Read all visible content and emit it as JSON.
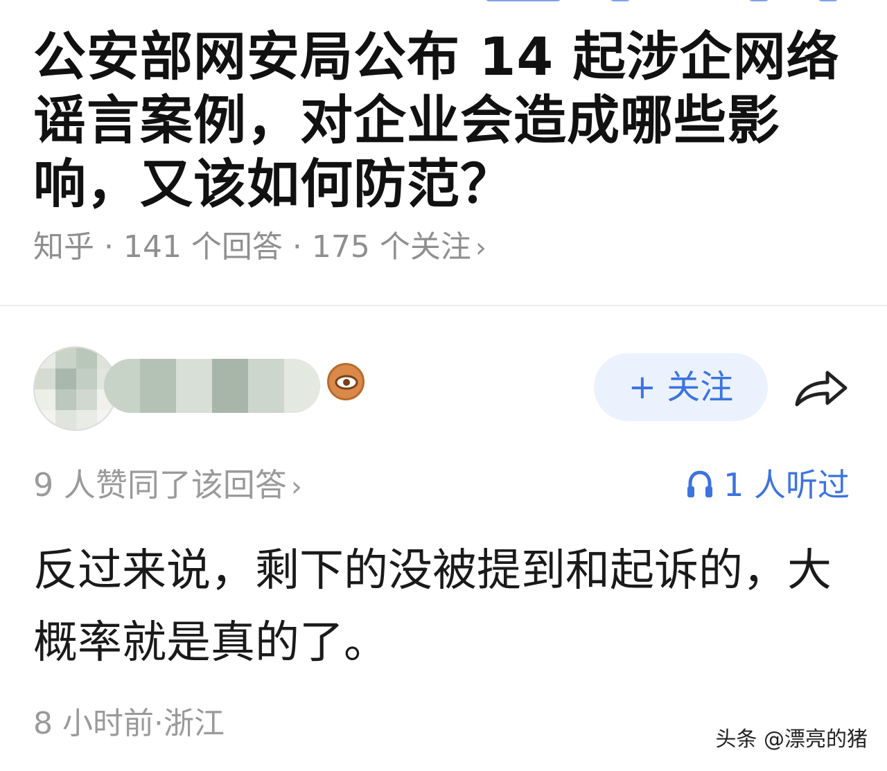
{
  "question": {
    "title": "公安部网安局公布 14 起涉企网络谣言案例，对企业会造成哪些影响，又该如何防范？",
    "meta": "知乎 · 141 个回答 · 175 个关注",
    "meta_chevron": "›"
  },
  "answer": {
    "follow_label": "+ 关注",
    "likes_text": "9 人赞同了该回答",
    "likes_chevron": "›",
    "listened_text": "1 人听过",
    "body": "反过来说，剩下的没被提到和起诉的，大概率就是真的了。",
    "time_location": "8 小时前·浙江"
  },
  "watermark": "头条 @漂亮的猪",
  "icons": {
    "share": "share-arrow-icon",
    "headphones": "headphones-icon",
    "badge": "eye-badge-icon"
  },
  "colors": {
    "accent": "#3c73e0",
    "follow_bg": "#ebf2fd",
    "meta_text": "#8f8f8f",
    "body_text": "#1a1a1a",
    "badge": "#d98a4a"
  }
}
